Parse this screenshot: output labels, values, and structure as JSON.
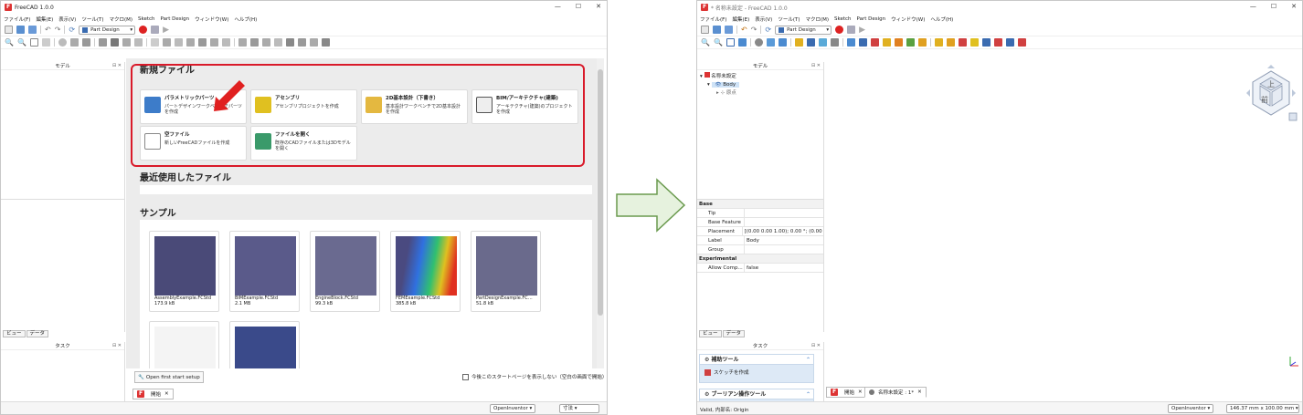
{
  "left": {
    "title": "FreeCAD 1.0.0",
    "menu": [
      "ファイル(F)",
      "編集(E)",
      "表示(V)",
      "ツール(T)",
      "マクロ(M)",
      "Sketch",
      "Part Design",
      "ウィンドウ(W)",
      "ヘルプ(H)"
    ],
    "workbench": "Part Design",
    "model_panel_title": "モデル",
    "view_tabs": [
      "ビュー",
      "データ"
    ],
    "task_panel_title": "タスク",
    "start": {
      "new_file_heading": "新規ファイル",
      "cards": [
        {
          "title": "パラメトリックパーツ",
          "desc": "パートデザインワークベンチでパーツを作成"
        },
        {
          "title": "アセンブリ",
          "desc": "アセンブリプロジェクトを作成"
        },
        {
          "title": "2D基本設計（下書き）",
          "desc": "基本設計ワークベンチで2D基本設計を作成"
        },
        {
          "title": "BIM/アーキテクチャ(建築)",
          "desc": "アーキテクチャ(建築)のプロジェクトを作成"
        },
        {
          "title": "空ファイル",
          "desc": "新しいFreeCADファイルを作成"
        },
        {
          "title": "ファイルを開く",
          "desc": "既存のCADファイルまたは3Dモデルを開く"
        }
      ],
      "recent_heading": "最近使用したファイル",
      "samples_heading": "サンプル",
      "samples": [
        {
          "name": "AssemblyExample.FCStd",
          "size": "173.9 kB"
        },
        {
          "name": "BIMExample.FCStd",
          "size": "2.1 MB"
        },
        {
          "name": "EngineBlock.FCStd",
          "size": "99.3 kB"
        },
        {
          "name": "FEMExample.FCStd",
          "size": "385.8 kB"
        },
        {
          "name": "PartDesignExample.FC…",
          "size": "51.8 kB"
        }
      ],
      "first_setup": "Open first start setup",
      "dont_show": "今後このスタートページを表示しない（空白の画面で開始）"
    },
    "doc_tab": "開始",
    "nav_style": "OpenInventor",
    "units": "寸法"
  },
  "right": {
    "title": "* 名称未設定 - FreeCAD 1.0.0",
    "menu": [
      "ファイル(F)",
      "編集(E)",
      "表示(V)",
      "ツール(T)",
      "マクロ(M)",
      "Sketch",
      "Part Design",
      "ウィンドウ(W)",
      "ヘルプ(H)"
    ],
    "workbench": "Part Design",
    "model_panel_title": "モデル",
    "tree": {
      "doc": "名称未設定",
      "body": "Body",
      "origin": "原点"
    },
    "props": {
      "group_base": "Base",
      "rows": [
        {
          "k": "Tip",
          "v": ""
        },
        {
          "k": "Base Feature",
          "v": ""
        },
        {
          "k": "Placement",
          "v": "[(0.00 0.00 1.00); 0.00 °; (0.00 ..."
        },
        {
          "k": "Label",
          "v": "Body"
        },
        {
          "k": "Group",
          "v": ""
        }
      ],
      "group_exp": "Experimental",
      "exp_rows": [
        {
          "k": "Allow Comp...",
          "v": "false"
        }
      ]
    },
    "view_tabs": [
      "ビュー",
      "データ"
    ],
    "task_panel_title": "タスク",
    "tasks": {
      "helper": "補助ツール",
      "create_sketch": "スケッチを作成",
      "boolean": "ブーリアン操作ツール"
    },
    "doc_tabs": [
      "開始",
      "名称未設定 : 1*"
    ],
    "cube": {
      "top": "上",
      "front": "前"
    },
    "status": "Valid, 内部名: Origin",
    "nav_style": "OpenInventor",
    "dims": "146.37 mm x 100.00 mm"
  }
}
